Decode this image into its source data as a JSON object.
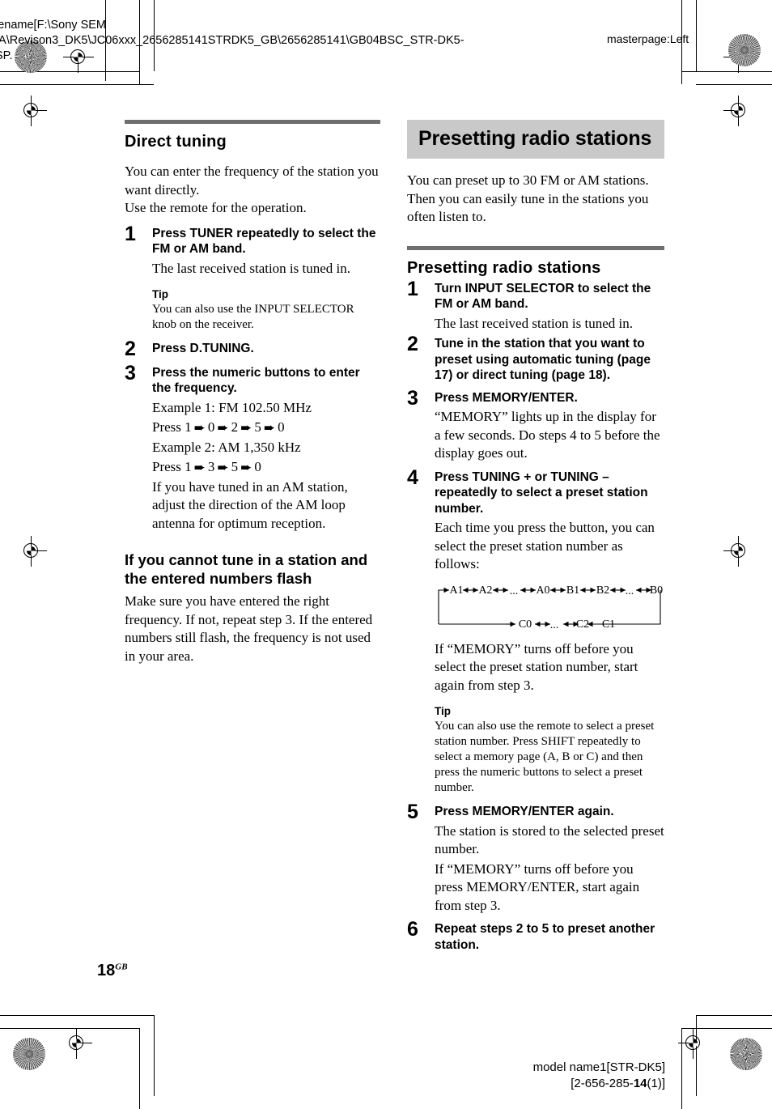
{
  "print_marks": {
    "filename_slug": "lename[F:\\Sony SEM\nIA\\Revison3_DK5\\JC06xxx_2656285141STRDK5_GB\\2656285141\\GB04BSC_STR-DK5-\nSP.",
    "masterpage_slug": "masterpage:Left",
    "footer_model": "model name1[STR-DK5]",
    "footer_code_prefix": "[2-656-285-",
    "footer_code_bold": "14",
    "footer_code_suffix": "(1)]"
  },
  "folio": {
    "page_number": "18",
    "region_suffix": "GB"
  },
  "left_column": {
    "section_heading": "Direct tuning",
    "intro_lines": [
      "You can enter the frequency of the station you want directly.",
      "Use the remote for the operation."
    ],
    "steps": [
      {
        "num": "1",
        "title": "Press TUNER repeatedly to select the FM or AM band.",
        "body": [
          "The last received station is tuned in."
        ],
        "tip": {
          "label": "Tip",
          "text": "You can also use the INPUT SELECTOR knob on the receiver."
        }
      },
      {
        "num": "2",
        "title": "Press D.TUNING.",
        "body": []
      },
      {
        "num": "3",
        "title": "Press the numeric buttons to enter the frequency.",
        "body": [
          "Example 1: FM 102.50 MHz",
          "PRESS_SEQ_1",
          "Example 2: AM 1,350 kHz",
          "PRESS_SEQ_2",
          "If you have tuned in an AM station, adjust the direction of the AM loop antenna for optimum reception."
        ],
        "press_sequence_1": {
          "prefix": "Press",
          "keys": [
            "1",
            "0",
            "2",
            "5",
            "0"
          ]
        },
        "press_sequence_2": {
          "prefix": "Press",
          "keys": [
            "1",
            "3",
            "5",
            "0"
          ]
        }
      }
    ],
    "subsection": {
      "heading": "If you cannot tune in a station and the entered numbers flash",
      "body": "Make sure you have entered the right frequency. If not, repeat step 3. If the entered numbers still flash, the frequency is not used in your area."
    }
  },
  "right_column": {
    "banner_title": "Presetting radio stations",
    "intro": "You can preset up to 30 FM or AM stations. Then you can easily tune in the stations you often listen to.",
    "section_heading": "Presetting radio stations",
    "steps": [
      {
        "num": "1",
        "title": "Turn INPUT SELECTOR to select the FM or AM band.",
        "body": [
          "The last received station is tuned in."
        ]
      },
      {
        "num": "2",
        "title": "Tune in the station that you want to preset using automatic tuning (page 17) or direct tuning (page 18).",
        "body": []
      },
      {
        "num": "3",
        "title": "Press MEMORY/ENTER.",
        "body": [
          "“MEMORY” lights up in the display for a few seconds. Do steps 4 to 5 before the display goes out."
        ]
      },
      {
        "num": "4",
        "title": "Press TUNING + or TUNING – repeatedly to select a preset station number.",
        "body": [
          "Each time you press the button, you can select the preset station number as follows:"
        ],
        "after_diagram_body": [
          "If “MEMORY” turns off before you select the preset station number, start again from step 3."
        ],
        "tip": {
          "label": "Tip",
          "text": "You can also use the remote to select a preset station number. Press SHIFT repeatedly to select a memory page (A, B or C) and then press the numeric buttons to select a preset number."
        }
      },
      {
        "num": "5",
        "title": "Press MEMORY/ENTER again.",
        "body": [
          "The station is stored to the selected preset number.",
          "If “MEMORY” turns off before you press MEMORY/ENTER, start again from step 3."
        ]
      },
      {
        "num": "6",
        "title": "Repeat steps 2 to 5 to preset another station.",
        "body": []
      }
    ],
    "cycle_diagram": {
      "row_top": [
        "A1",
        "A2",
        "...",
        "A0",
        "B1",
        "B2",
        "...",
        "B0"
      ],
      "row_bottom": [
        "C0",
        "...",
        "C2",
        "C1"
      ],
      "connector": "wraps from B0 down and around back to A1"
    }
  }
}
